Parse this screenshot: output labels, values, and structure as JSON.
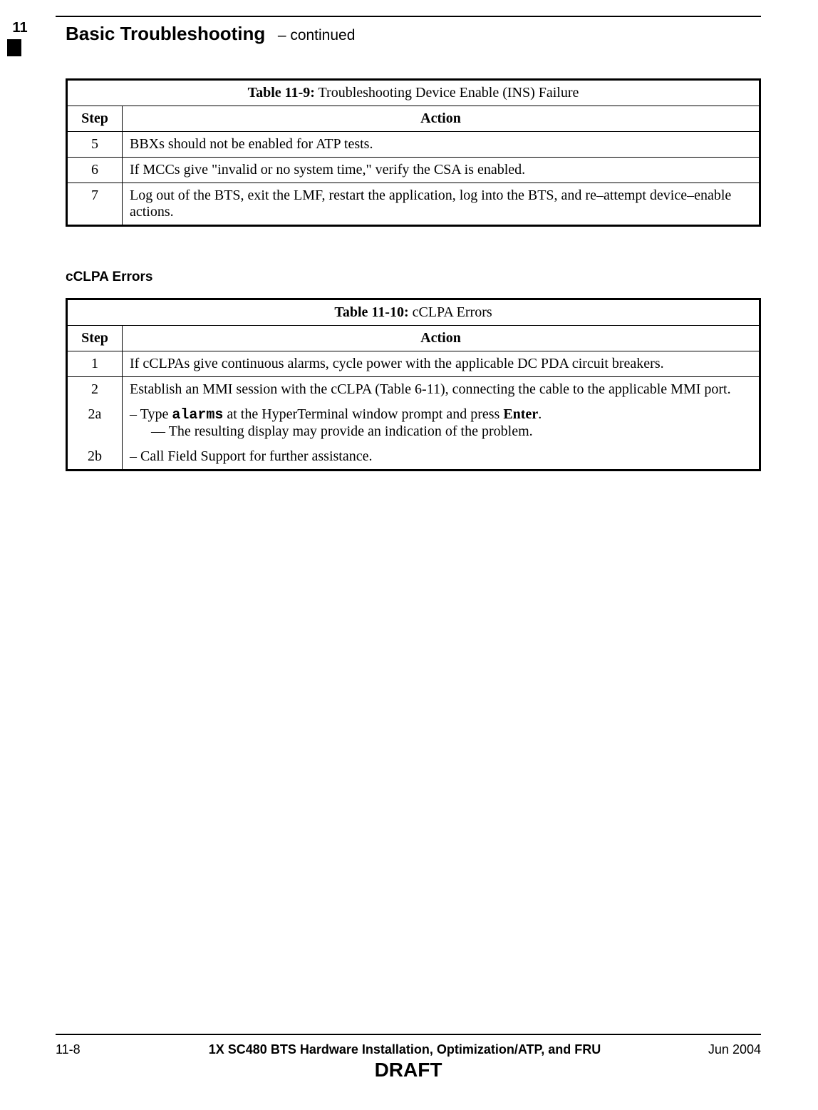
{
  "chapter_number": "11",
  "running_head": {
    "title": "Basic Troubleshooting",
    "continued": "– continued"
  },
  "table9": {
    "label": "Table 11-9:",
    "title": " Troubleshooting Device Enable (INS) Failure",
    "col_step": "Step",
    "col_action": "Action",
    "rows": [
      {
        "step": "5",
        "action": "BBXs should not be enabled for ATP tests."
      },
      {
        "step": "6",
        "action": "If MCCs give \"invalid or no system time,\" verify the CSA is enabled."
      },
      {
        "step": "7",
        "action": "Log out of the BTS, exit the LMF, restart the application, log into the BTS, and re–attempt device–enable actions."
      }
    ]
  },
  "section_heading": "cCLPA Errors",
  "table10": {
    "label": "Table 11-10:",
    "title": " cCLPA Errors",
    "col_step": "Step",
    "col_action": "Action",
    "rows": {
      "r1": {
        "step": "1",
        "action": "If cCLPAs give continuous alarms, cycle power with the applicable DC PDA circuit breakers."
      },
      "r2": {
        "step": "2",
        "action": "Establish an MMI session with the cCLPA (Table 6-11), connecting the cable to the applicable MMI port."
      },
      "r2a": {
        "step": "2a",
        "line1_prefix": "–  Type ",
        "line1_code": "alarms",
        "line1_suffix": " at the HyperTerminal window prompt and press ",
        "line1_bold": "Enter",
        "line1_end": ".",
        "line2": "—   The resulting display may provide an indication of the problem."
      },
      "r2b": {
        "step": "2b",
        "action": "–  Call Field Support for further assistance."
      }
    }
  },
  "footer": {
    "page": "11-8",
    "doc_title": "1X SC480 BTS Hardware Installation, Optimization/ATP, and FRU",
    "date": "Jun 2004",
    "draft": "DRAFT"
  }
}
